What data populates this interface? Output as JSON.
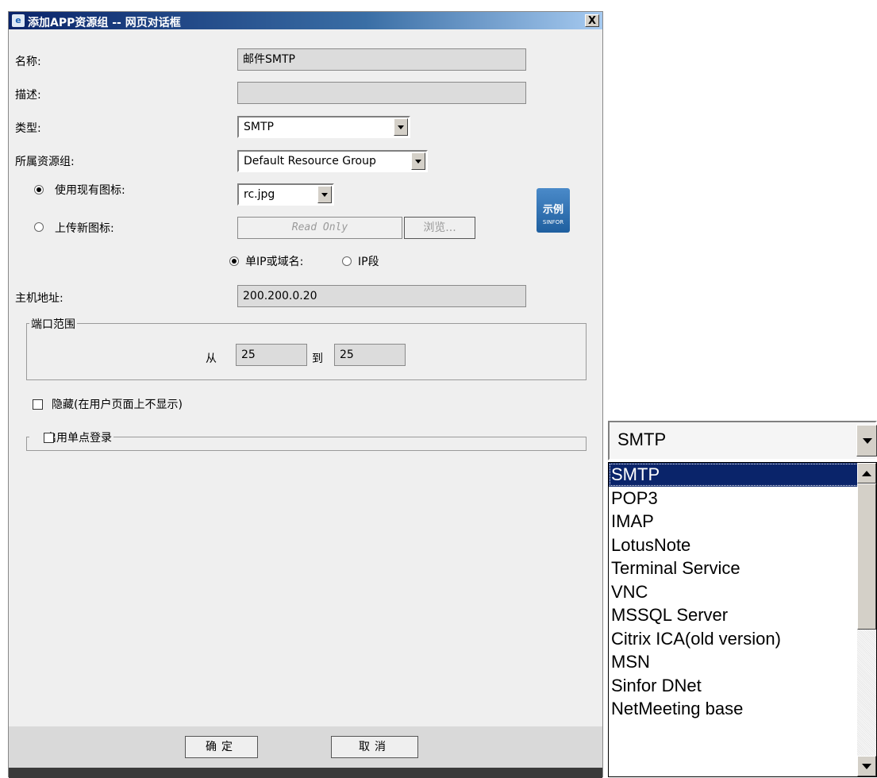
{
  "window": {
    "title": "添加APP资源组 -- 网页对话框",
    "close_label": "X"
  },
  "form": {
    "name_label": "名称:",
    "name_value": "邮件SMTP",
    "desc_label": "描述:",
    "desc_value": "",
    "type_label": "类型:",
    "type_value": "SMTP",
    "group_label": "所属资源组:",
    "group_value": "Default Resource Group",
    "use_icon_label": "使用现有图标:",
    "icon_value": "rc.jpg",
    "upload_icon_label": "上传新图标:",
    "upload_placeholder": "Read Only",
    "browse_label": "浏览...",
    "sample_icon_text": "示例",
    "sample_icon_brand": "SINFOR",
    "single_ip_label": "单IP或域名:",
    "ip_range_label": "IP段",
    "host_label": "主机地址:",
    "host_value": "200.200.0.20",
    "port_range_legend": "端口范围",
    "port_from_label": "从",
    "port_from_value": "25",
    "port_to_label": "到",
    "port_to_value": "25",
    "hide_label": "隐藏(在用户页面上不显示)",
    "sso_label": "启用单点登录"
  },
  "footer": {
    "ok_label": "确定",
    "cancel_label": "取消"
  },
  "dropdown": {
    "current": "SMTP",
    "options": [
      "SMTP",
      "POP3",
      "IMAP",
      "LotusNote",
      "Terminal Service",
      "VNC",
      "MSSQL Server",
      "Citrix ICA(old version)",
      "MSN",
      "Sinfor DNet",
      "NetMeeting base"
    ],
    "selected_index": 0
  },
  "colors": {
    "title_bar": "#0a246a",
    "selected_item": "#0a246a",
    "dialog_bg": "#efefef"
  }
}
